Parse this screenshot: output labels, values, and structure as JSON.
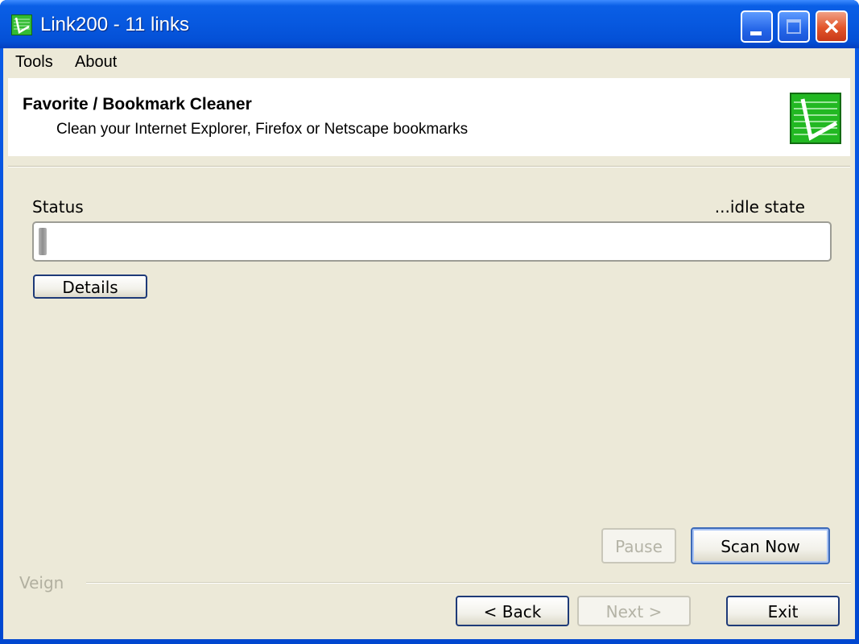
{
  "window": {
    "title": "Link200 - 11 links",
    "icon": "link200-app-icon",
    "controls": [
      "minimize-icon",
      "maximize-icon",
      "close-icon"
    ]
  },
  "menu": {
    "items": [
      {
        "label": "Tools"
      },
      {
        "label": "About"
      }
    ]
  },
  "header": {
    "title": "Favorite / Bookmark Cleaner",
    "subtitle": "Clean your Internet Explorer,  Firefox or Netscape bookmarks",
    "logo": "link200-logo-icon"
  },
  "status": {
    "label": "Status",
    "state": "...idle state",
    "progress_fraction": 0.01
  },
  "buttons": {
    "details": "Details",
    "pause": "Pause",
    "scan_now": "Scan Now",
    "back": "< Back",
    "next": "Next >",
    "exit": "Exit"
  },
  "footer": {
    "brand": "Veign"
  },
  "colors": {
    "titlebar": "#0758df",
    "client_bg": "#ece9d8",
    "logo_green": "#22b822",
    "button_border": "#1e3a78"
  }
}
